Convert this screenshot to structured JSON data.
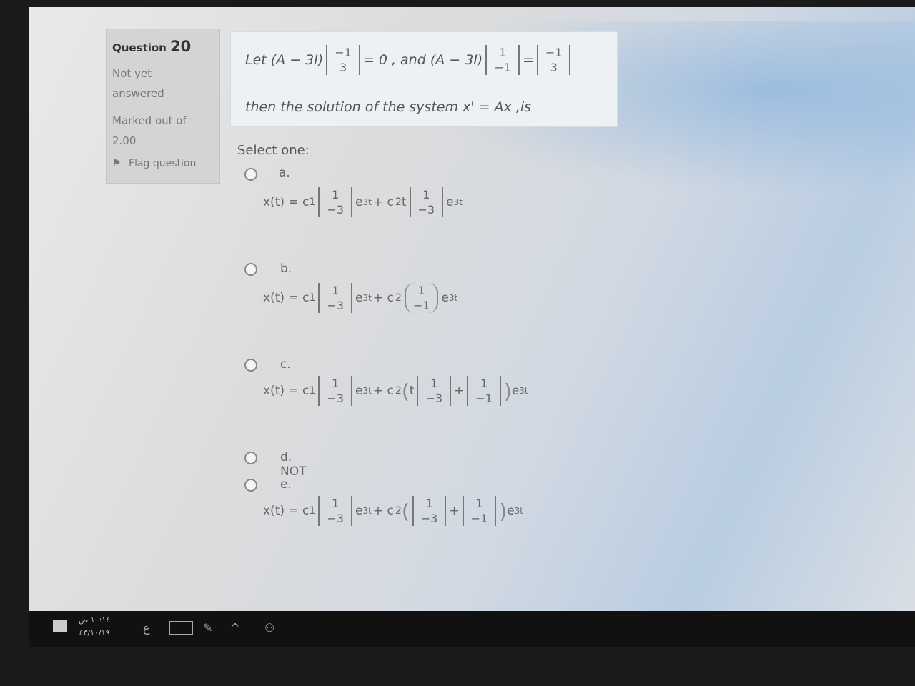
{
  "question": {
    "label": "Question",
    "number": "20",
    "state_line1": "Not yet",
    "state_line2": "answered",
    "marked_line1": "Marked out of",
    "marked_line2": "2.00",
    "flag_label": "Flag question"
  },
  "prompt": {
    "let": "Let (A − 3I)",
    "eq0": "= 0 , and (A − 3I)",
    "eq": "=",
    "then": "then the solution of the system  x' = Ax ,is",
    "v1": [
      "−1",
      "3"
    ],
    "v2": [
      "1",
      "−1"
    ],
    "v3": [
      "−1",
      "3"
    ]
  },
  "select_one": "Select one:",
  "options": [
    {
      "label": "a.",
      "lhs": "x(t) = c",
      "sub1": "1",
      "v1": [
        "1",
        "−3"
      ],
      "e1": "e",
      "exp1": "3t",
      "plus": "+ c",
      "sub2": "2",
      "t": "t",
      "v2": [
        "1",
        "−3"
      ],
      "e2": "e",
      "exp2": "3t"
    },
    {
      "label": "b.",
      "lhs": "x(t) = c",
      "sub1": "1",
      "v1": [
        "1",
        "−3"
      ],
      "e1": "e",
      "exp1": "3t",
      "plus": "+ c",
      "sub2": "2",
      "v2": [
        "1",
        "−1"
      ],
      "e2": "e",
      "exp2": "3t"
    },
    {
      "label": "c.",
      "lhs": "x(t) = c",
      "sub1": "1",
      "v1": [
        "1",
        "−3"
      ],
      "e1": "e",
      "exp1": "3t",
      "plus": "+ c",
      "sub2": "2",
      "t": "t",
      "v2": [
        "1",
        "−3"
      ],
      "plus2": "+",
      "v3": [
        "1",
        "−1"
      ],
      "e2": "e",
      "exp2": "3t"
    },
    {
      "label": "d. NOT"
    },
    {
      "label": "e.",
      "lhs": "x(t) = c",
      "sub1": "1",
      "v1": [
        "1",
        "−3"
      ],
      "e1": "e",
      "exp1": "3t",
      "plus": "+ c",
      "sub2": "2",
      "v2": [
        "1",
        "−3"
      ],
      "plus2": "+",
      "v3": [
        "1",
        "−1"
      ],
      "e2": "e",
      "exp2": "3t"
    }
  ],
  "taskbar": {
    "time": "١٠:١٤ ص",
    "date": "٤٣/١٠/١٩",
    "lang": "ع"
  }
}
